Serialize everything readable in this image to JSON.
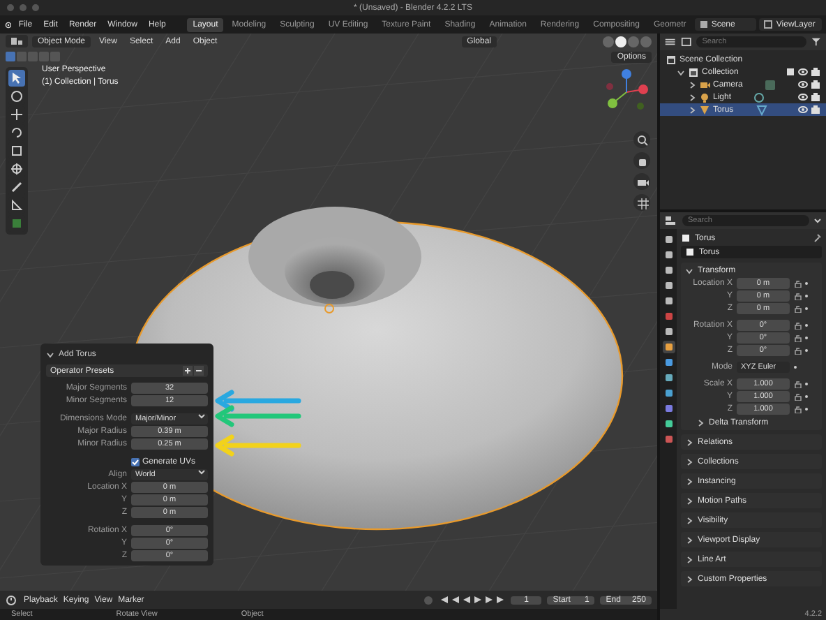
{
  "window": {
    "title": "* (Unsaved) - Blender 4.2.2 LTS"
  },
  "menu": [
    "File",
    "Edit",
    "Render",
    "Window",
    "Help"
  ],
  "workspaces": [
    {
      "label": "Layout",
      "selected": true
    },
    {
      "label": "Modeling",
      "selected": false
    },
    {
      "label": "Sculpting",
      "selected": false
    },
    {
      "label": "UV Editing",
      "selected": false
    },
    {
      "label": "Texture Paint",
      "selected": false
    },
    {
      "label": "Shading",
      "selected": false
    },
    {
      "label": "Animation",
      "selected": false
    },
    {
      "label": "Rendering",
      "selected": false
    },
    {
      "label": "Compositing",
      "selected": false
    },
    {
      "label": "Geometr",
      "selected": false
    }
  ],
  "scene": "Scene",
  "view_layer": "ViewLayer",
  "viewport": {
    "mode": "Object Mode",
    "menus": [
      "View",
      "Select",
      "Add",
      "Object"
    ],
    "orientation": "Global",
    "options": "Options",
    "perspective": "User Perspective",
    "context": "(1) Collection | Torus",
    "tools": [
      {
        "selected": true
      },
      {
        "selected": false
      },
      {
        "selected": false
      },
      {
        "selected": false
      },
      {
        "selected": false
      },
      {
        "selected": false
      },
      {
        "selected": false
      },
      {
        "selected": false
      },
      {
        "selected": false
      }
    ],
    "select_modes": [
      {
        "selected": true
      },
      {
        "selected": false
      },
      {
        "selected": false
      },
      {
        "selected": false
      },
      {
        "selected": false
      }
    ],
    "shading_modes": [
      {
        "selected": false
      },
      {
        "selected": true
      },
      {
        "selected": false
      },
      {
        "selected": false
      }
    ]
  },
  "add_torus": {
    "title": "Add Torus",
    "expanded": true,
    "presets": "Operator Presets",
    "groups": [
      [
        {
          "label": "Major Segments",
          "value": "32",
          "kind": "number"
        },
        {
          "label": "Minor Segments",
          "value": "12",
          "kind": "number"
        }
      ],
      [
        {
          "label": "Dimensions Mode",
          "value": "Major/Minor",
          "kind": "dropdown"
        },
        {
          "label": "Major Radius",
          "value": "0.39 m",
          "kind": "number"
        },
        {
          "label": "Minor Radius",
          "value": "0.25 m",
          "kind": "number"
        }
      ],
      [
        {
          "label": "Generate UVs",
          "checked": true,
          "kind": "checkbox"
        },
        {
          "label": "Align",
          "value": "World",
          "kind": "dropdown"
        },
        {
          "label": "Location X",
          "value": "0 m",
          "kind": "number"
        },
        {
          "label": "Y",
          "value": "0 m",
          "kind": "number"
        },
        {
          "label": "Z",
          "value": "0 m",
          "kind": "number"
        }
      ],
      [
        {
          "label": "Rotation X",
          "value": "0°",
          "kind": "number"
        },
        {
          "label": "Y",
          "value": "0°",
          "kind": "number"
        },
        {
          "label": "Z",
          "value": "0°",
          "kind": "number"
        }
      ]
    ]
  },
  "annotation_arrows": [
    {
      "color": "#29a8e0"
    },
    {
      "color": "#22c77a"
    },
    {
      "color": "#f2d21b"
    }
  ],
  "timeline": {
    "menus": [
      "Playback",
      "Keying",
      "View",
      "Marker"
    ],
    "frame": "1",
    "start_label": "Start",
    "start": "1",
    "end_label": "End",
    "end": "250"
  },
  "status_bar": [
    "Select",
    "Rotate View",
    "Object"
  ],
  "outliner": {
    "search_placeholder": "Search",
    "tree": [
      {
        "label": "Scene Collection",
        "kind": "scene",
        "selected": false,
        "children": [
          {
            "label": "Collection",
            "kind": "collection",
            "expanded": true,
            "selected": false,
            "children": [
              {
                "label": "Camera",
                "kind": "camera",
                "expanded": false,
                "selected": false
              },
              {
                "label": "Light",
                "kind": "light",
                "expanded": false,
                "selected": false
              },
              {
                "label": "Torus",
                "kind": "mesh",
                "expanded": false,
                "selected": true
              }
            ]
          }
        ]
      }
    ]
  },
  "properties": {
    "search_placeholder": "Search",
    "object": "Torus",
    "name": "Torus",
    "tabs": [
      {
        "selected": false
      },
      {
        "selected": false
      },
      {
        "selected": false
      },
      {
        "selected": false
      },
      {
        "selected": false
      },
      {
        "selected": false
      },
      {
        "selected": false
      },
      {
        "selected": true
      },
      {
        "selected": false
      },
      {
        "selected": false
      },
      {
        "selected": false
      },
      {
        "selected": false
      },
      {
        "selected": false
      },
      {
        "selected": false
      }
    ],
    "transform": {
      "title": "Transform",
      "expanded": true,
      "groups": [
        [
          {
            "label": "Location X",
            "value": "0 m"
          },
          {
            "label": "Y",
            "value": "0 m"
          },
          {
            "label": "Z",
            "value": "0 m"
          }
        ],
        [
          {
            "label": "Rotation X",
            "value": "0°"
          },
          {
            "label": "Y",
            "value": "0°"
          },
          {
            "label": "Z",
            "value": "0°"
          }
        ],
        [
          {
            "label": "Mode",
            "value": "XYZ Euler",
            "kind": "dropdown"
          }
        ],
        [
          {
            "label": "Scale X",
            "value": "1.000"
          },
          {
            "label": "Y",
            "value": "1.000"
          },
          {
            "label": "Z",
            "value": "1.000"
          }
        ]
      ],
      "subpanel": {
        "title": "Delta Transform",
        "expanded": false
      }
    },
    "panels": [
      {
        "title": "Relations",
        "expanded": false
      },
      {
        "title": "Collections",
        "expanded": false
      },
      {
        "title": "Instancing",
        "expanded": false
      },
      {
        "title": "Motion Paths",
        "expanded": false
      },
      {
        "title": "Visibility",
        "expanded": false
      },
      {
        "title": "Viewport Display",
        "expanded": false
      },
      {
        "title": "Line Art",
        "expanded": false
      },
      {
        "title": "Custom Properties",
        "expanded": false
      }
    ],
    "version": "4.2.2"
  }
}
